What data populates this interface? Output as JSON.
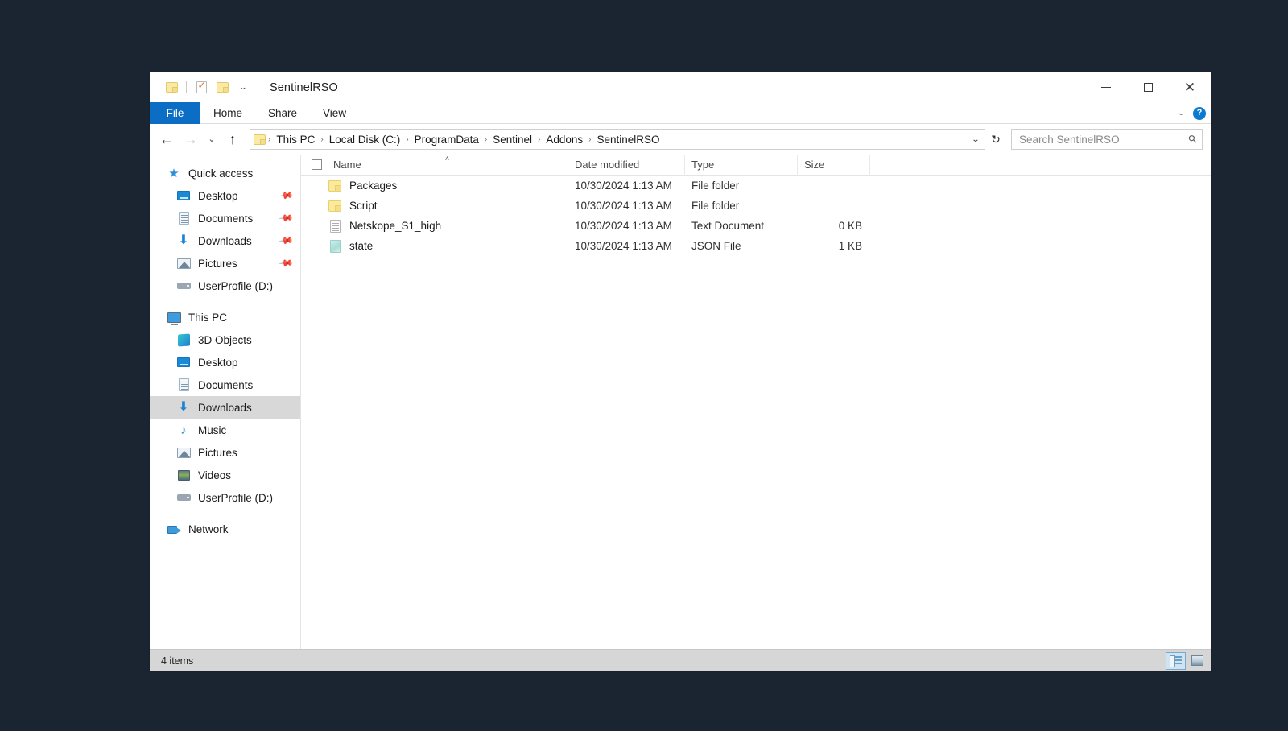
{
  "window": {
    "title": "SentinelRSO",
    "quick_access_toolbar": [
      {
        "name": "properties-folder-icon",
        "icon": "folder-icon"
      },
      {
        "name": "properties-icon",
        "icon": "properties-checkbox-icon"
      },
      {
        "name": "new-folder-icon",
        "icon": "folder-icon"
      },
      {
        "name": "customize-qat-dropdown",
        "icon": "chevron-down-icon"
      }
    ],
    "controls": {
      "minimize": "minimize-icon",
      "maximize": "maximize-icon",
      "close": "close-icon"
    }
  },
  "ribbon": {
    "tabs": [
      {
        "label": "File",
        "active": true
      },
      {
        "label": "Home",
        "active": false
      },
      {
        "label": "Share",
        "active": false
      },
      {
        "label": "View",
        "active": false
      }
    ],
    "expand_icon": "chevron-down-icon",
    "help_label": "?"
  },
  "addressbar": {
    "back_icon": "arrow-left-icon",
    "forward_icon": "arrow-right-icon",
    "recent_icon": "chevron-down-icon",
    "up_icon": "arrow-up-icon",
    "folder_icon": "folder-icon",
    "breadcrumbs": [
      "This PC",
      "Local Disk (C:)",
      "ProgramData",
      "Sentinel",
      "Addons",
      "SentinelRSO"
    ],
    "separator": "›",
    "dropdown_icon": "chevron-down-icon",
    "refresh_icon": "refresh-icon"
  },
  "search": {
    "placeholder": "Search SentinelRSO",
    "value": "",
    "icon": "search-icon"
  },
  "sidebar": {
    "groups": [
      {
        "header": {
          "label": "Quick access",
          "icon": "star-icon"
        },
        "items": [
          {
            "label": "Desktop",
            "icon": "monitor-icon",
            "pinned": true
          },
          {
            "label": "Documents",
            "icon": "document-icon",
            "pinned": true
          },
          {
            "label": "Downloads",
            "icon": "download-arrow-icon",
            "pinned": true
          },
          {
            "label": "Pictures",
            "icon": "picture-icon",
            "pinned": true
          },
          {
            "label": "UserProfile (D:)",
            "icon": "drive-icon",
            "pinned": false
          }
        ]
      },
      {
        "header": {
          "label": "This PC",
          "icon": "this-pc-icon"
        },
        "items": [
          {
            "label": "3D Objects",
            "icon": "3d-objects-icon",
            "pinned": false
          },
          {
            "label": "Desktop",
            "icon": "monitor-icon",
            "pinned": false
          },
          {
            "label": "Documents",
            "icon": "document-icon",
            "pinned": false
          },
          {
            "label": "Downloads",
            "icon": "download-arrow-icon",
            "pinned": false,
            "selected": true
          },
          {
            "label": "Music",
            "icon": "music-note-icon",
            "pinned": false
          },
          {
            "label": "Pictures",
            "icon": "picture-icon",
            "pinned": false
          },
          {
            "label": "Videos",
            "icon": "video-icon",
            "pinned": false
          },
          {
            "label": "UserProfile (D:)",
            "icon": "drive-icon",
            "pinned": false
          }
        ]
      },
      {
        "header": {
          "label": "Network",
          "icon": "network-icon"
        },
        "items": []
      }
    ]
  },
  "filelist": {
    "columns": [
      {
        "key": "name",
        "label": "Name",
        "sorted": "asc"
      },
      {
        "key": "date",
        "label": "Date modified"
      },
      {
        "key": "type",
        "label": "Type"
      },
      {
        "key": "size",
        "label": "Size"
      }
    ],
    "sort_caret": "˄",
    "rows": [
      {
        "name": "Packages",
        "date": "10/30/2024 1:13 AM",
        "type": "File folder",
        "size": "",
        "icon": "folder-icon"
      },
      {
        "name": "Script",
        "date": "10/30/2024 1:13 AM",
        "type": "File folder",
        "size": "",
        "icon": "folder-icon"
      },
      {
        "name": "Netskope_S1_high",
        "date": "10/30/2024 1:13 AM",
        "type": "Text Document",
        "size": "0 KB",
        "icon": "text-document-icon"
      },
      {
        "name": "state",
        "date": "10/30/2024 1:13 AM",
        "type": "JSON File",
        "size": "1 KB",
        "icon": "json-file-icon"
      }
    ]
  },
  "statusbar": {
    "item_count": "4 items",
    "views": [
      {
        "name": "details-view",
        "active": true
      },
      {
        "name": "large-icons-view",
        "active": false
      }
    ]
  },
  "colors": {
    "desktop_background": "#1b2532",
    "accent_tab": "#0b6ec4",
    "selection": "#d8d8d8",
    "hover": "#e9f2fb",
    "statusbar": "#d6d6d6"
  }
}
